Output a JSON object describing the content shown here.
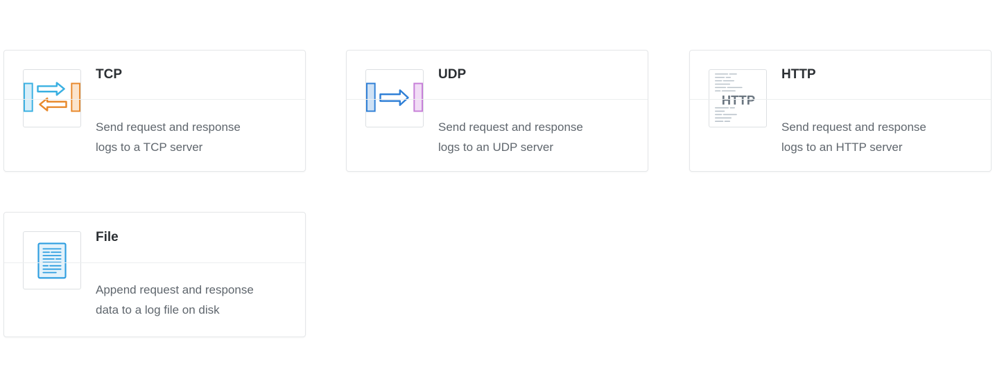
{
  "cards": [
    {
      "title": "TCP",
      "description_line1": "Send request and response",
      "description_line2": "logs to a TCP server",
      "icon": "tcp-bidirectional-arrows-icon"
    },
    {
      "title": "UDP",
      "description_line1": "Send request and response",
      "description_line2": "logs to an UDP server",
      "icon": "udp-one-way-arrow-icon"
    },
    {
      "title": "HTTP",
      "description_line1": "Send request and response",
      "description_line2": "logs to an HTTP server",
      "icon": "http-document-icon",
      "icon_text": "HTTP"
    },
    {
      "title": "File",
      "description_line1": "Append request and response",
      "description_line2": "data to a log file on disk",
      "icon": "file-document-icon"
    }
  ],
  "colors": {
    "tcp_blue": "#3ab0e2",
    "tcp_orange": "#e8892c",
    "udp_blue": "#2f7fd6",
    "udp_purple": "#c77fd8",
    "file_blue": "#2f9ee0"
  }
}
